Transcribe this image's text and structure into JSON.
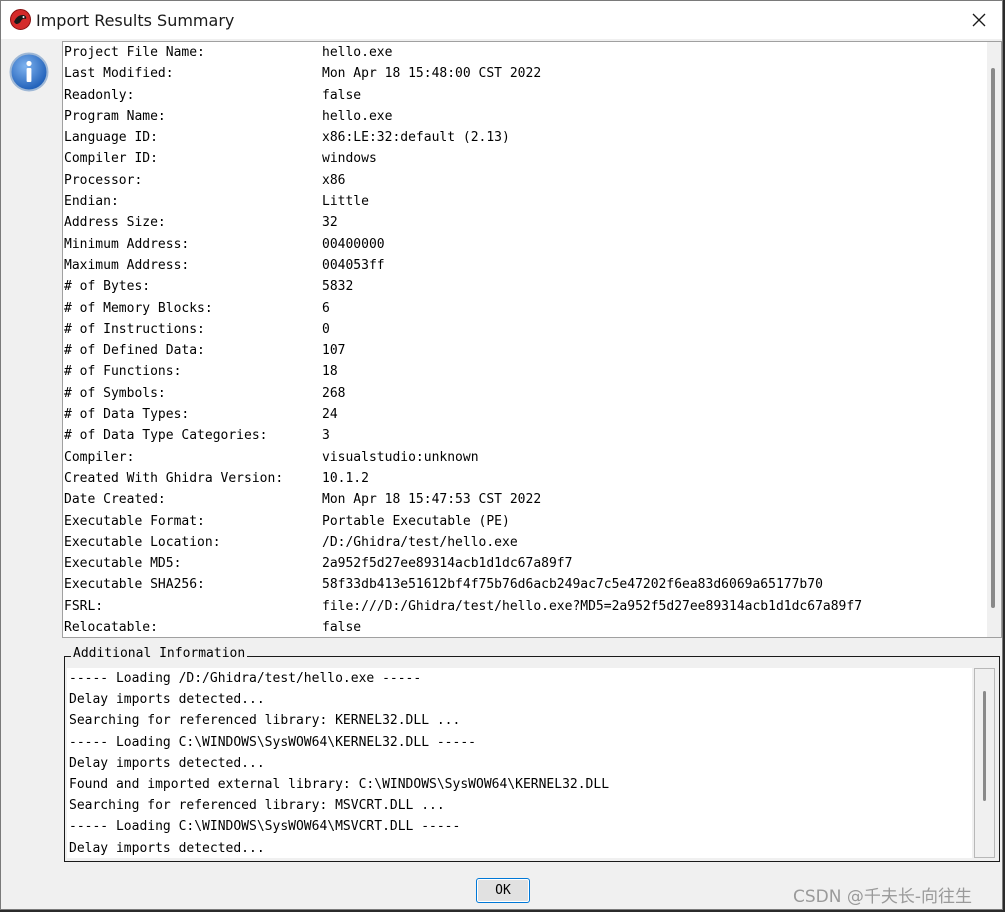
{
  "window": {
    "title": "Import Results Summary"
  },
  "properties": [
    {
      "key": "Project File Name:",
      "value": "hello.exe"
    },
    {
      "key": "Last Modified:",
      "value": "Mon Apr 18 15:48:00 CST 2022"
    },
    {
      "key": "Readonly:",
      "value": "false"
    },
    {
      "key": "Program Name:",
      "value": "hello.exe"
    },
    {
      "key": "Language ID:",
      "value": "x86:LE:32:default (2.13)"
    },
    {
      "key": "Compiler ID:",
      "value": "windows"
    },
    {
      "key": "Processor:",
      "value": "x86"
    },
    {
      "key": "Endian:",
      "value": "Little"
    },
    {
      "key": "Address Size:",
      "value": "32"
    },
    {
      "key": "Minimum Address:",
      "value": "00400000"
    },
    {
      "key": "Maximum Address:",
      "value": "004053ff"
    },
    {
      "key": "# of Bytes:",
      "value": "5832"
    },
    {
      "key": "# of Memory Blocks:",
      "value": "6"
    },
    {
      "key": "# of Instructions:",
      "value": "0"
    },
    {
      "key": "# of Defined Data:",
      "value": "107"
    },
    {
      "key": "# of Functions:",
      "value": "18"
    },
    {
      "key": "# of Symbols:",
      "value": "268"
    },
    {
      "key": "# of Data Types:",
      "value": "24"
    },
    {
      "key": "# of Data Type Categories:",
      "value": "3"
    },
    {
      "key": "Compiler:",
      "value": "visualstudio:unknown"
    },
    {
      "key": "Created With Ghidra Version:",
      "value": "10.1.2"
    },
    {
      "key": "Date Created:",
      "value": "Mon Apr 18 15:47:53 CST 2022"
    },
    {
      "key": "Executable Format:",
      "value": "Portable Executable (PE)"
    },
    {
      "key": "Executable Location:",
      "value": "/D:/Ghidra/test/hello.exe"
    },
    {
      "key": "Executable MD5:",
      "value": "2a952f5d27ee89314acb1d1dc67a89f7"
    },
    {
      "key": "Executable SHA256:",
      "value": "58f33db413e51612bf4f75b76d6acb249ac7c5e47202f6ea83d6069a65177b70"
    },
    {
      "key": "FSRL:",
      "value": "file:///D:/Ghidra/test/hello.exe?MD5=2a952f5d27ee89314acb1d1dc67a89f7"
    },
    {
      "key": "Relocatable:",
      "value": "false"
    }
  ],
  "additional": {
    "legend": "Additional Information",
    "lines": [
      "----- Loading /D:/Ghidra/test/hello.exe -----",
      "Delay imports detected...",
      "Searching for referenced library: KERNEL32.DLL ...",
      "----- Loading C:\\WINDOWS\\SysWOW64\\KERNEL32.DLL -----",
      "Delay imports detected...",
      "Found and imported external library: C:\\WINDOWS\\SysWOW64\\KERNEL32.DLL",
      "Searching for referenced library: MSVCRT.DLL ...",
      "----- Loading C:\\WINDOWS\\SysWOW64\\MSVCRT.DLL -----",
      "Delay imports detected..."
    ]
  },
  "buttons": {
    "ok": "OK"
  },
  "watermark": "CSDN @千夫长-向往生",
  "icons": {
    "app": "ghidra-dragon-icon",
    "info": "info-icon",
    "close": "close-icon"
  },
  "colors": {
    "window_bg": "#f0f0f0",
    "info_blue": "#2a6fc9",
    "app_red": "#d42a2a",
    "ok_border": "#0078d7"
  }
}
